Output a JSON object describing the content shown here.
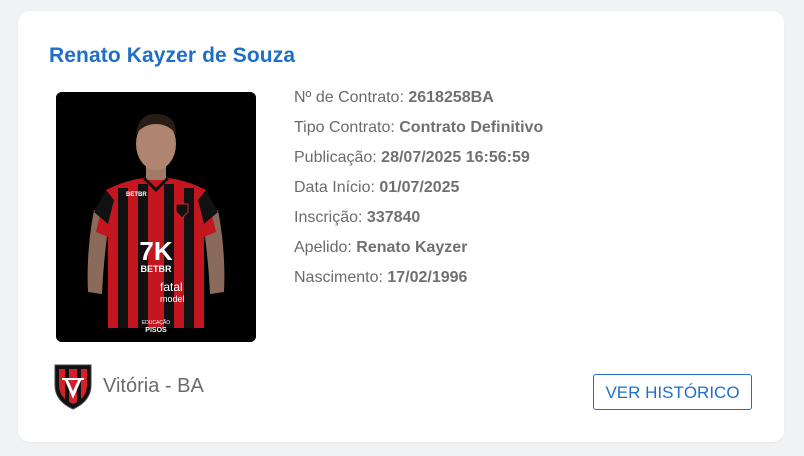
{
  "player": {
    "name": "Renato Kayzer de Souza",
    "photo_icon": "player-photo",
    "shirt_text": {
      "sponsor_top_left": "BETBR",
      "sponsor_main": "7K",
      "sponsor_main_sub": "BETBR",
      "sponsor_mid_brand": "fatal",
      "sponsor_mid_sub": "model",
      "sponsor_bottom": "EDUCAÇÃO",
      "sponsor_bottom_sub": "PISOS"
    }
  },
  "fields": [
    {
      "label": "Nº de Contrato: ",
      "value": "2618258BA"
    },
    {
      "label": "Tipo Contrato: ",
      "value": "Contrato Definitivo"
    },
    {
      "label": "Publicação: ",
      "value": "28/07/2025 16:56:59"
    },
    {
      "label": "Data Início: ",
      "value": "01/07/2025"
    },
    {
      "label": "Inscrição: ",
      "value": "337840"
    },
    {
      "label": "Apelido: ",
      "value": "Renato Kayzer"
    },
    {
      "label": "Nascimento: ",
      "value": "17/02/1996"
    }
  ],
  "club": {
    "name": "Vitória - BA",
    "crest_icon": "club-crest-icon",
    "colors": {
      "red": "#d4202a",
      "black": "#111111"
    }
  },
  "actions": {
    "history_button": "VER HISTÓRICO"
  },
  "colors": {
    "accent": "#1f6fc7",
    "text": "#6b6b6b",
    "background": "#f1f2f4",
    "card": "#ffffff"
  }
}
